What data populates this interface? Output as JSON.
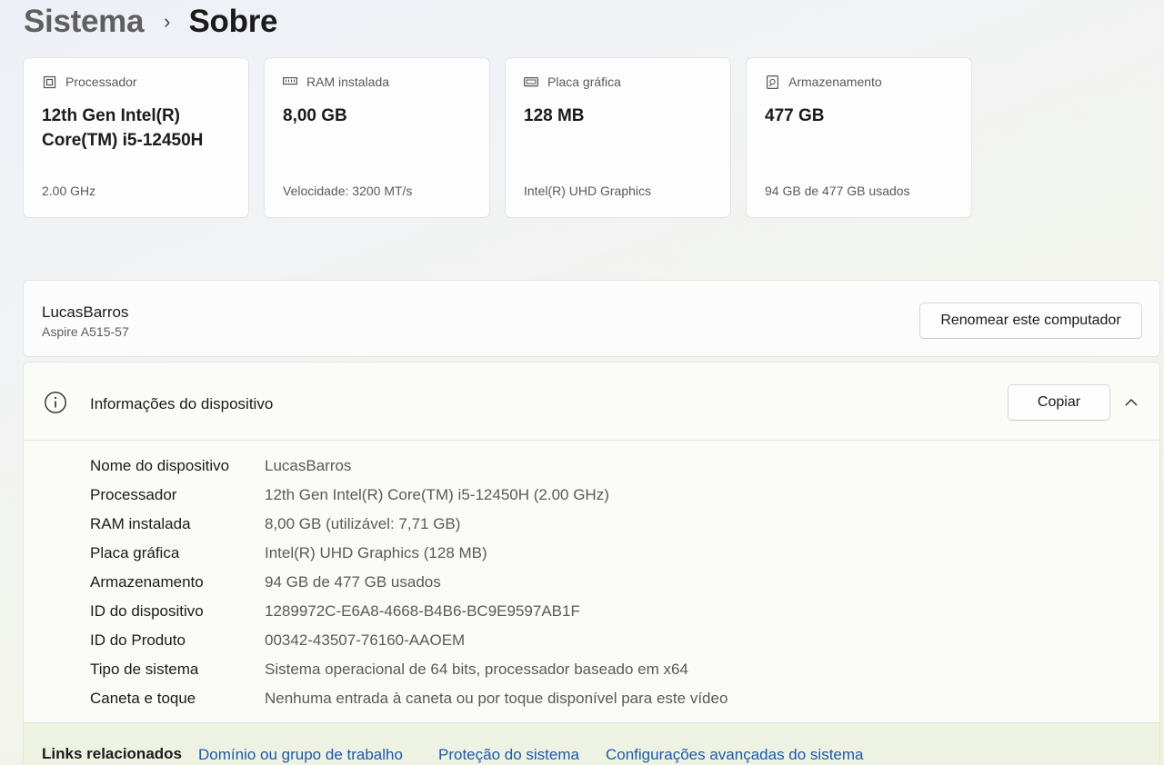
{
  "breadcrumb": {
    "parent": "Sistema",
    "separator": "›",
    "current": "Sobre"
  },
  "specs": [
    {
      "label": "Processador",
      "icon": "processor-icon",
      "value": "12th Gen Intel(R) Core(TM) i5-12450H",
      "sub": "2.00 GHz"
    },
    {
      "label": "RAM instalada",
      "icon": "ram-icon",
      "value": "8,00 GB",
      "sub": "Velocidade: 3200 MT/s"
    },
    {
      "label": "Placa gráfica",
      "icon": "gpu-icon",
      "value": "128 MB",
      "sub": "Intel(R) UHD Graphics"
    },
    {
      "label": "Armazenamento",
      "icon": "storage-icon",
      "value": "477 GB",
      "sub": "94 GB de 477 GB usados"
    }
  ],
  "device": {
    "name": "LucasBarros",
    "model": "Aspire A515-57",
    "rename_label": "Renomear este computador"
  },
  "info": {
    "title": "Informações do dispositivo",
    "copy_label": "Copiar",
    "rows": [
      {
        "key": "Nome do dispositivo",
        "value": "LucasBarros"
      },
      {
        "key": "Processador",
        "value": "12th Gen Intel(R) Core(TM) i5-12450H (2.00 GHz)"
      },
      {
        "key": "RAM instalada",
        "value": "8,00 GB (utilizável: 7,71 GB)"
      },
      {
        "key": "Placa gráfica",
        "value": "Intel(R) UHD Graphics (128 MB)"
      },
      {
        "key": "Armazenamento",
        "value": "94 GB de 477 GB usados"
      },
      {
        "key": "ID do dispositivo",
        "value": "1289972C-E6A8-4668-B4B6-BC9E9597AB1F"
      },
      {
        "key": "ID do Produto",
        "value": "00342-43507-76160-AAOEM"
      },
      {
        "key": "Tipo de sistema",
        "value": "Sistema operacional de 64 bits, processador baseado em x64"
      },
      {
        "key": "Caneta e toque",
        "value": "Nenhuma entrada à caneta ou por toque disponível para este vídeo"
      }
    ]
  },
  "related": {
    "title": "Links relacionados",
    "links": [
      "Domínio ou grupo de trabalho",
      "Proteção do sistema",
      "Configurações avançadas do sistema"
    ]
  },
  "colors": {
    "link": "#1d5aa6",
    "text": "#1b1b1b",
    "secondary_text": "#5a5a5a"
  }
}
